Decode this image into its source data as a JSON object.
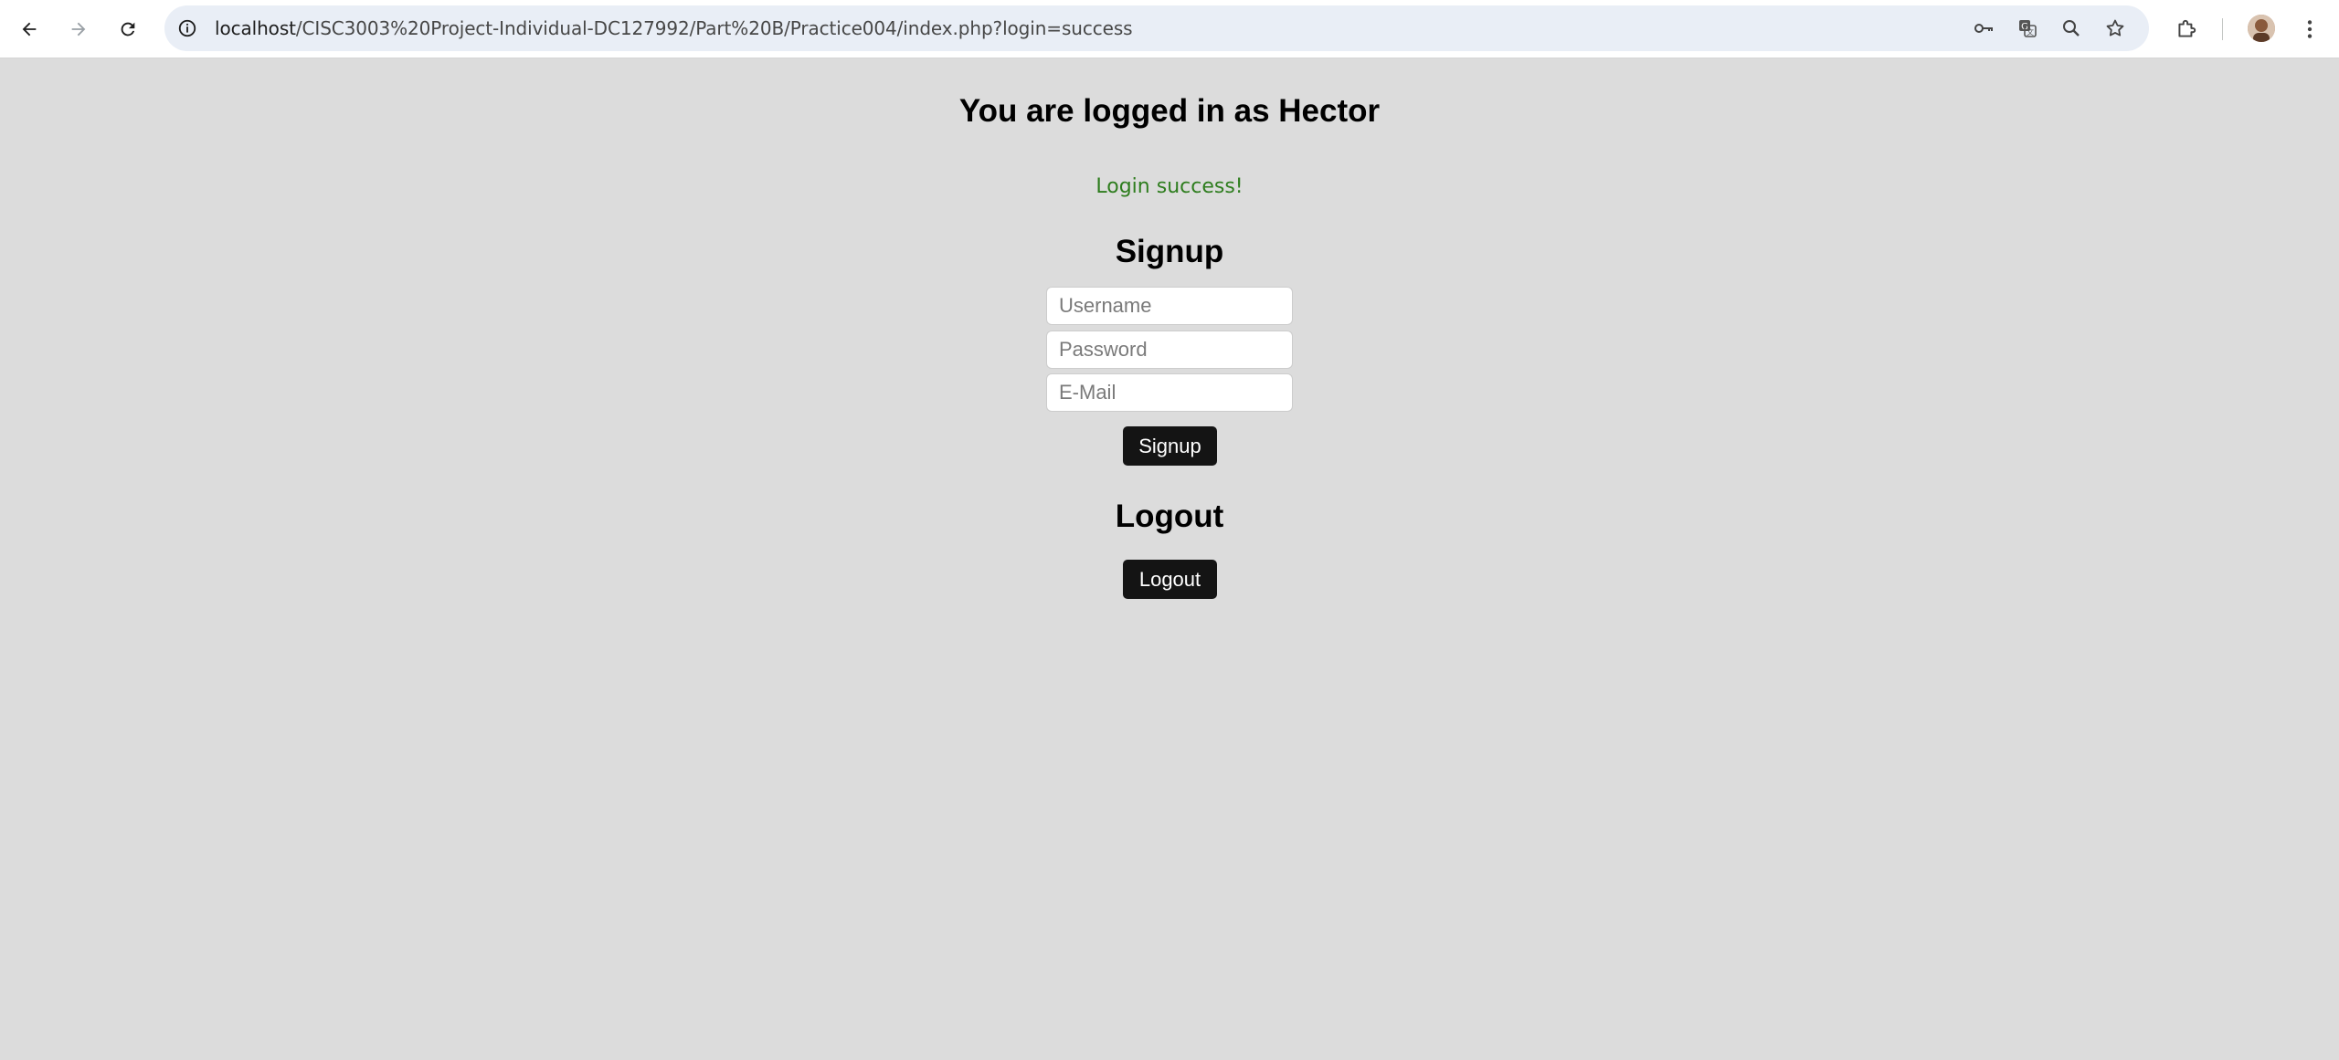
{
  "browser": {
    "url_host": "localhost",
    "url_path": "/CISC3003%20Project-Individual-DC127992/Part%20B/Practice004/index.php?login=success",
    "icons": {
      "back": "back-arrow-icon",
      "forward": "forward-arrow-icon",
      "reload": "reload-icon",
      "site_info": "site-info-icon",
      "password": "key-icon",
      "translate": "translate-icon",
      "zoom": "zoom-icon",
      "bookmark": "star-icon",
      "extensions": "puzzle-icon",
      "menu": "kebab-menu-icon"
    }
  },
  "page": {
    "heading": "You are logged in as Hector",
    "status_message": "Login success!",
    "status_color": "#2e7d1e",
    "background": "#dcdcdc"
  },
  "signup": {
    "title": "Signup",
    "username_placeholder": "Username",
    "password_placeholder": "Password",
    "email_placeholder": "E-Mail",
    "button_label": "Signup"
  },
  "logout": {
    "title": "Logout",
    "button_label": "Logout"
  }
}
